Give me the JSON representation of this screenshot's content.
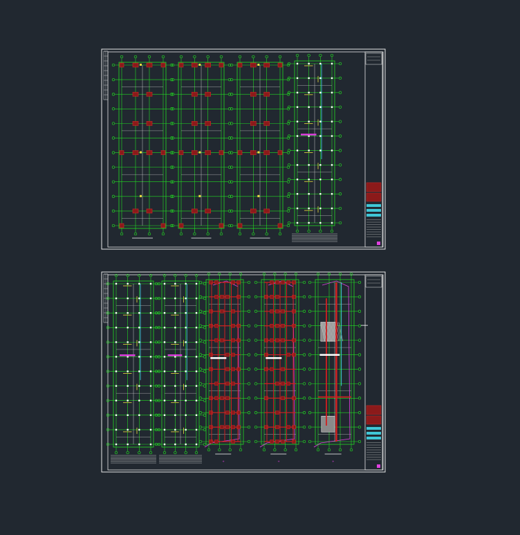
{
  "viewport": {
    "background": "#212830"
  },
  "colors": {
    "sheet_border": "#e8e8e8",
    "axis_grid": "#22dd22",
    "column_fill": "#8b1a1a",
    "column_outline": "#d02828",
    "beam_line": "#c8c8c8",
    "rebar_yellow": "#f0e040",
    "magenta": "#e040e0",
    "cyan": "#40c8d8",
    "white": "#ffffff",
    "red_beam": "#d02020"
  },
  "sheets": [
    {
      "id": "sheet-foundation-plans",
      "plan_count": 4,
      "plan_styles": [
        "foundation",
        "foundation",
        "foundation",
        "rebar"
      ]
    },
    {
      "id": "sheet-floor-plans",
      "plan_count": 5,
      "plan_styles": [
        "rebar",
        "rebar",
        "beam-dense",
        "beam-dense",
        "beam-hatched"
      ]
    }
  ],
  "title_block": {
    "stamp_colors": [
      "#8b1a1a",
      "#8b1a1a"
    ],
    "band_colors": [
      "#40c8d8",
      "#40c8d8",
      "#40c8d8"
    ],
    "legend_accent": "#e040e0"
  }
}
